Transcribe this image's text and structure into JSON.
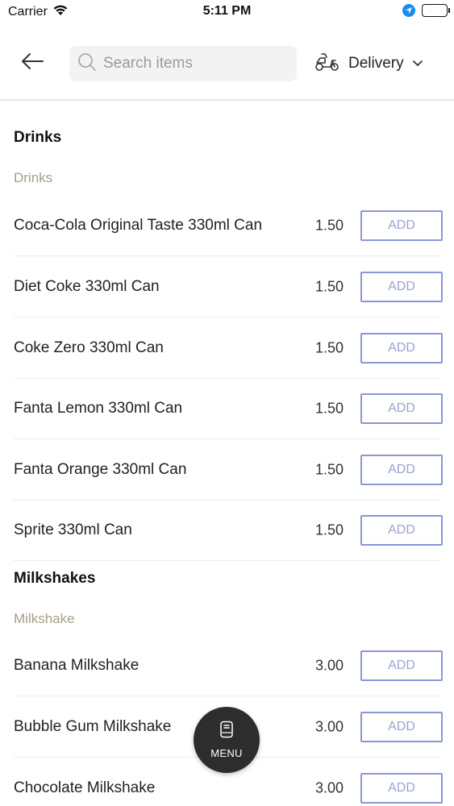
{
  "status_bar": {
    "carrier": "Carrier",
    "time": "5:11 PM"
  },
  "header": {
    "search_placeholder": "Search items",
    "delivery_label": "Delivery"
  },
  "sections": [
    {
      "title": "Drinks",
      "subtitle": "Drinks",
      "items": [
        {
          "name": "Coca-Cola Original Taste 330ml Can",
          "price": "1.50",
          "action": "ADD"
        },
        {
          "name": "Diet Coke 330ml Can",
          "price": "1.50",
          "action": "ADD"
        },
        {
          "name": "Coke Zero 330ml Can",
          "price": "1.50",
          "action": "ADD"
        },
        {
          "name": "Fanta Lemon 330ml Can",
          "price": "1.50",
          "action": "ADD"
        },
        {
          "name": "Fanta Orange 330ml Can",
          "price": "1.50",
          "action": "ADD"
        },
        {
          "name": "Sprite 330ml Can",
          "price": "1.50",
          "action": "ADD"
        }
      ]
    },
    {
      "title": "Milkshakes",
      "subtitle": "Milkshake",
      "items": [
        {
          "name": "Banana Milkshake",
          "price": "3.00",
          "action": "ADD"
        },
        {
          "name": "Bubble Gum Milkshake",
          "price": "3.00",
          "action": "ADD"
        },
        {
          "name": "Chocolate Milkshake",
          "price": "3.00",
          "action": "ADD"
        }
      ]
    }
  ],
  "menu_button": {
    "label": "MENU"
  },
  "colors": {
    "accent_border": "#8a97d6",
    "subtitle": "#a59f86",
    "fab": "#2d2d2d"
  }
}
